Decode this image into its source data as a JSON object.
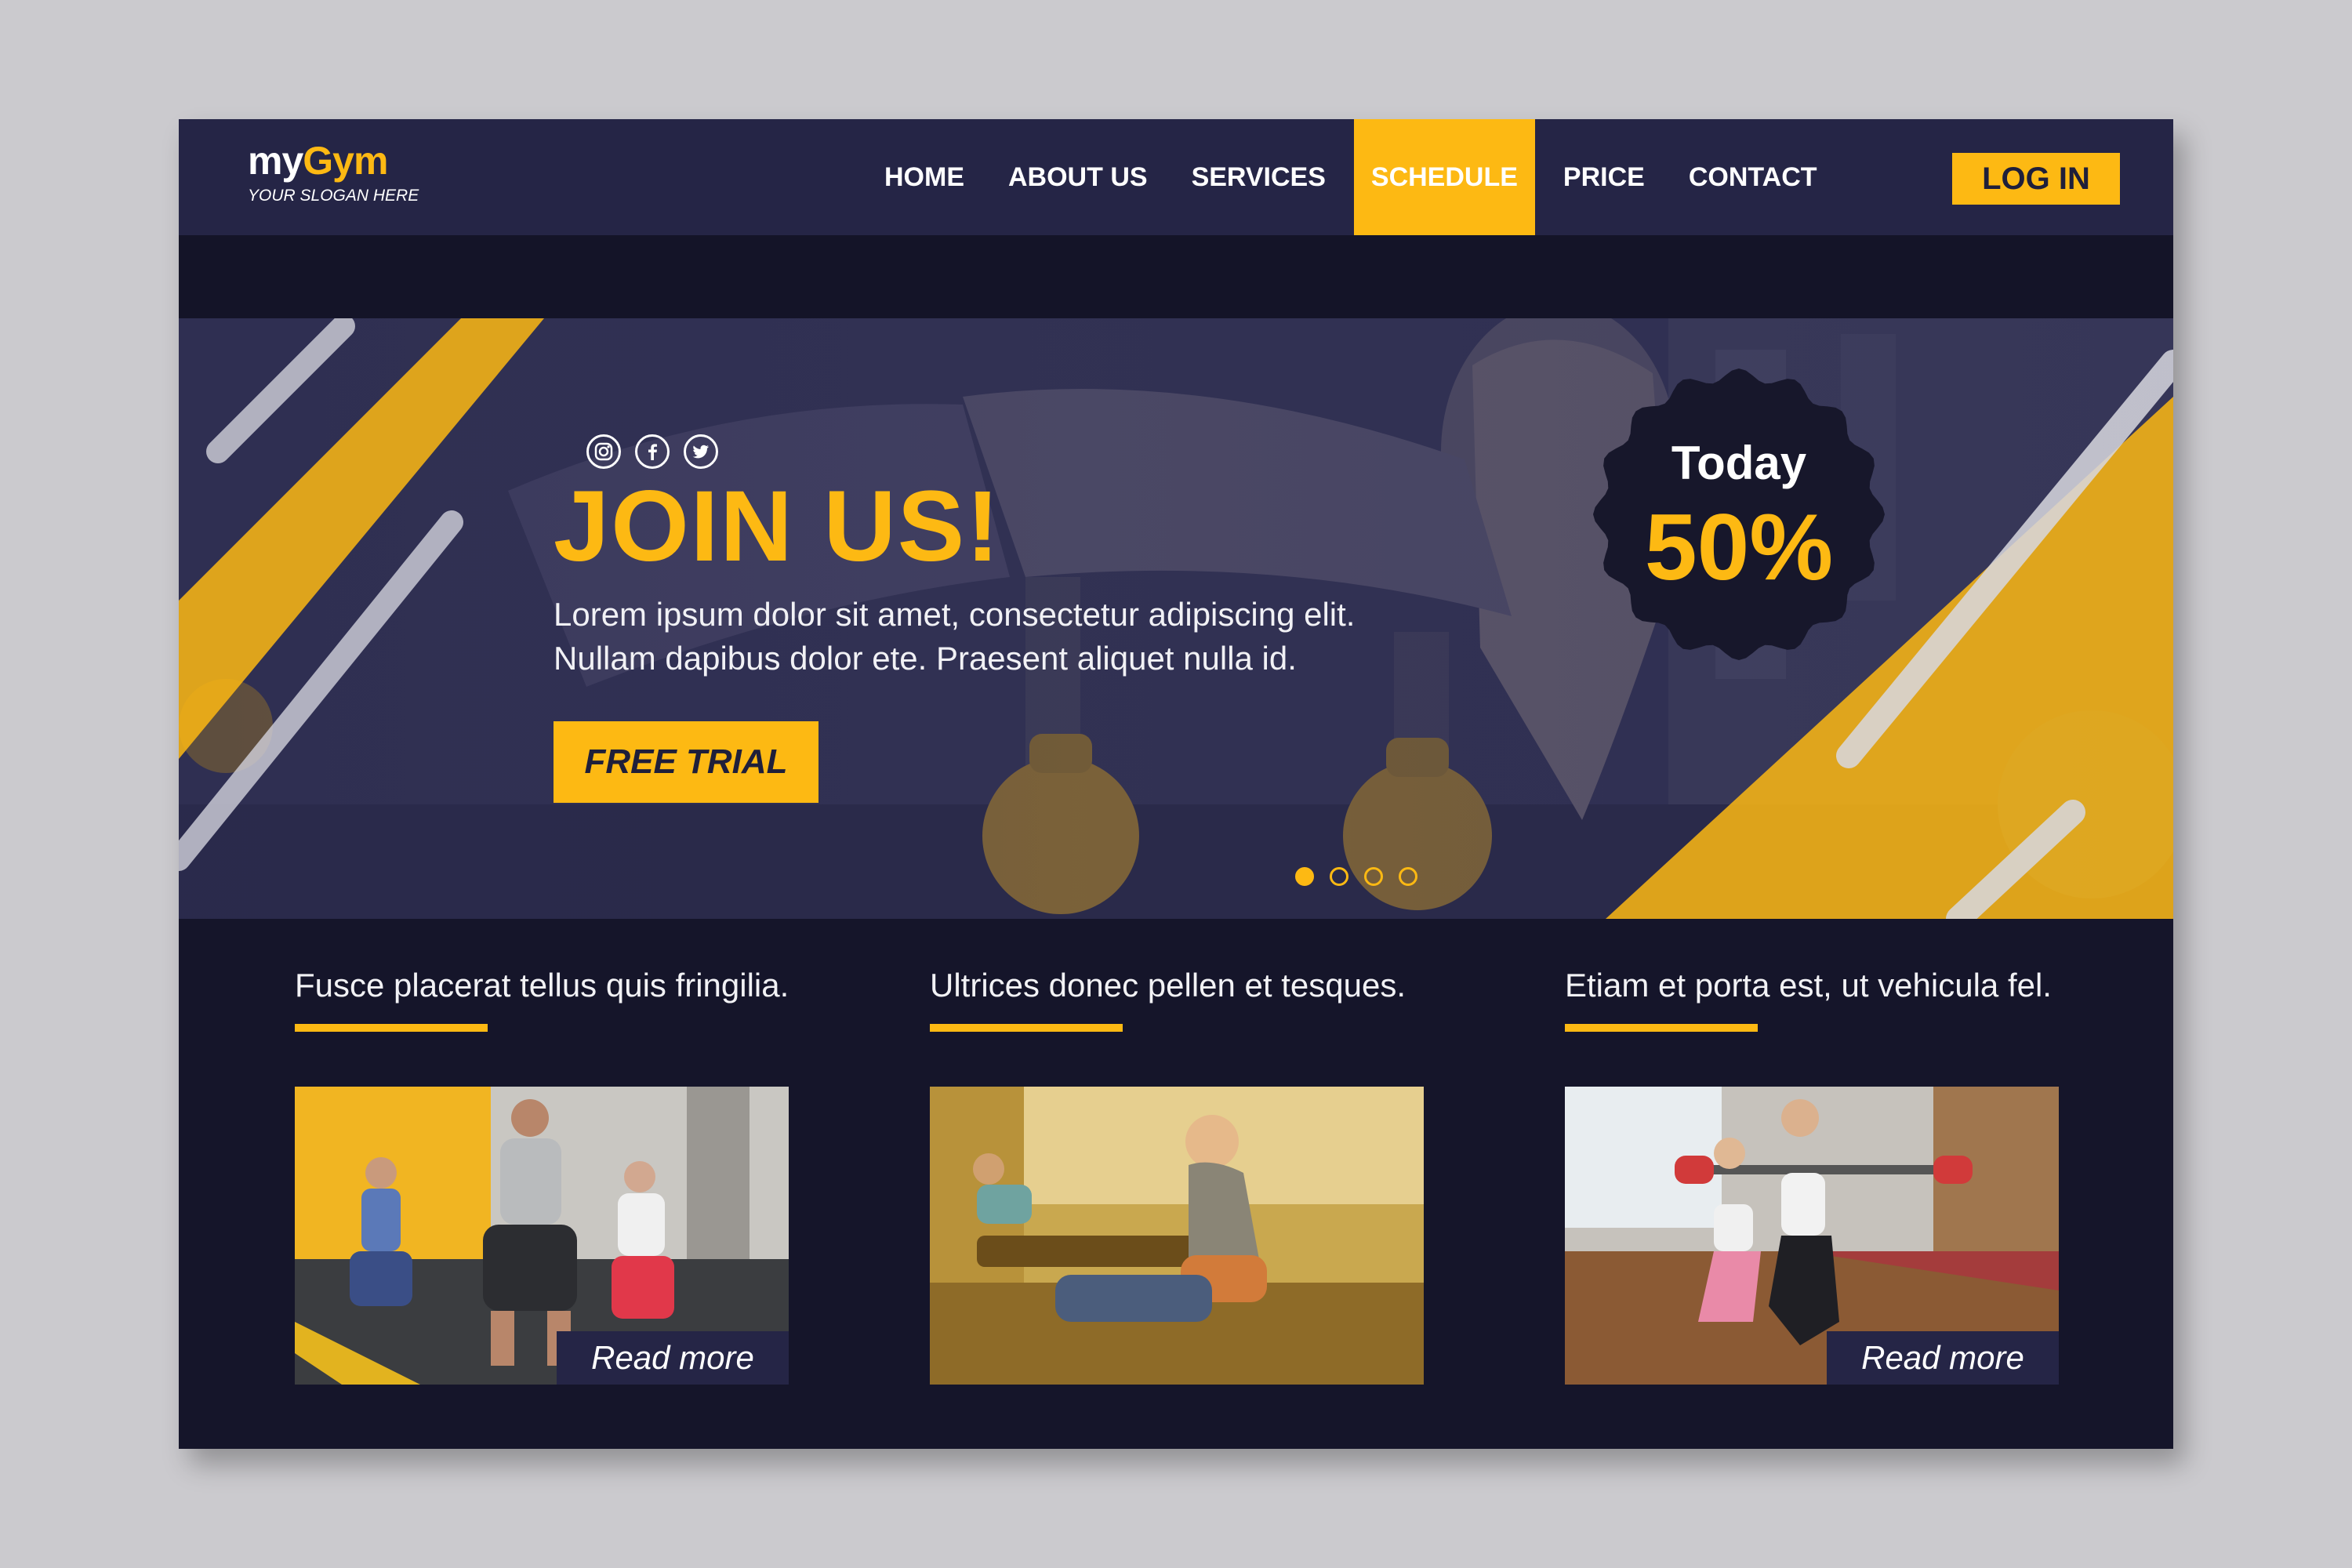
{
  "brand": {
    "name_my": "my",
    "name_gym": "Gym",
    "slogan": "YOUR SLOGAN HERE"
  },
  "nav": {
    "items": [
      {
        "label": "HOME"
      },
      {
        "label": "ABOUT US"
      },
      {
        "label": "SERVICES"
      },
      {
        "label": "SCHEDULE",
        "active": true
      },
      {
        "label": "PRICE"
      },
      {
        "label": "CONTACT"
      }
    ],
    "login_label": "LOG IN"
  },
  "hero": {
    "social_icons": [
      "instagram-icon",
      "facebook-icon",
      "twitter-icon"
    ],
    "title": "JOIN US!",
    "text_line1": "Lorem ipsum dolor sit amet, consectetur adipiscing elit.",
    "text_line2": "Nullam dapibus dolor ete. Praesent aliquet nulla id.",
    "cta_label": "FREE TRIAL",
    "slides_total": 4,
    "slide_active": 1,
    "badge_label": "Today",
    "badge_value": "50%"
  },
  "features": [
    {
      "title": "Fusce placerat tellus quis fringilia.",
      "read_more": "Read more"
    },
    {
      "title": "Ultrices donec pellen et tesques.",
      "read_more": ""
    },
    {
      "title": "Etiam et porta est, ut vehicula fel.",
      "read_more": "Read more"
    }
  ],
  "colors": {
    "accent": "#fdb913",
    "nav_bg": "#252546",
    "page_bg": "#15152a",
    "outer_bg": "#cbcace"
  }
}
